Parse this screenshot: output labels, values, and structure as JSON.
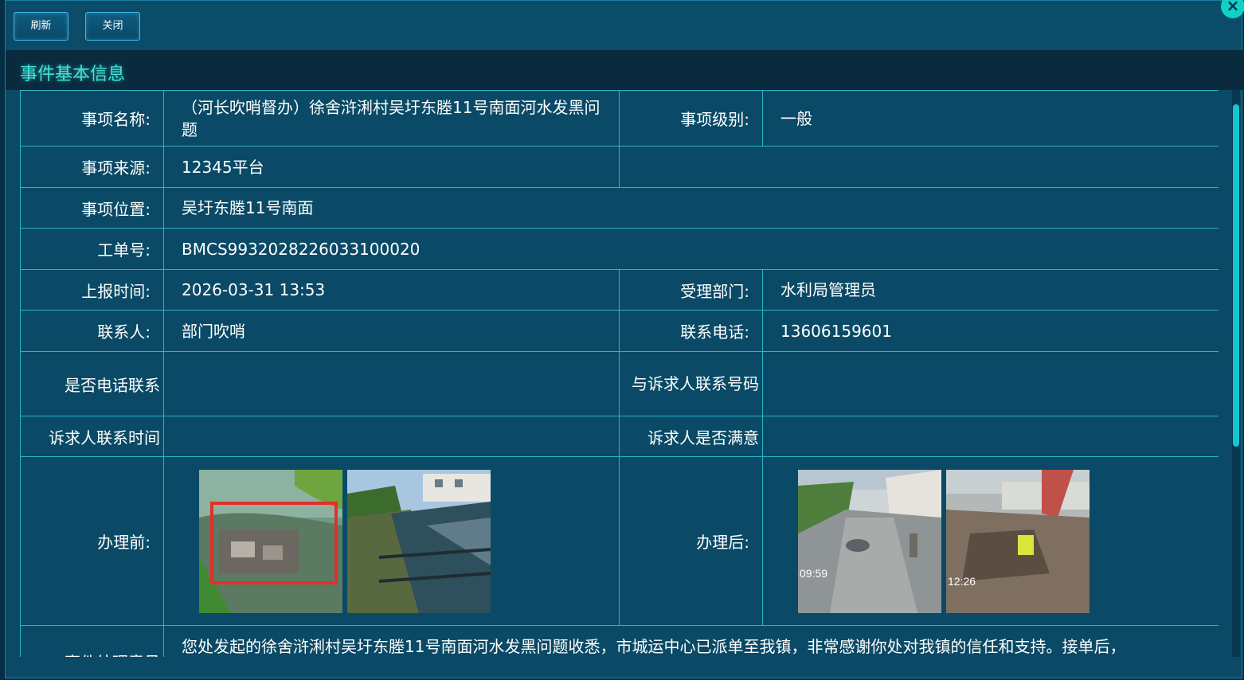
{
  "toolbar": {
    "refresh_label": "刷新",
    "close_label": "关闭"
  },
  "section": {
    "title": "事件基本信息"
  },
  "fields": {
    "item_name_label": "事项名称:",
    "item_name": "（河长吹哨督办）徐舍浒浰村吴圩东塍11号南面河水发黑问题",
    "item_level_label": "事项级别:",
    "item_level": "一般",
    "source_label": "事项来源:",
    "source": "12345平台",
    "location_label": "事项位置:",
    "location": "吴圩东塍11号南面",
    "order_no_label": "工单号:",
    "order_no": "BMCS993202822603310002​0",
    "report_time_label": "上报时间:",
    "report_time": "2026-03-31 13:53",
    "dept_label": "受理部门:",
    "dept": "水利局管理员",
    "contact_label": "联系人:",
    "contact": "部门吹哨",
    "phone_label": "联系电话:",
    "phone": "13606159601",
    "phone_contacted_label": "是否电话联系",
    "complainant_phone_label": "与诉求人联系号码",
    "complainant_time_label": "诉求人联系时间",
    "complainant_satisfied_label": "诉求人是否满意",
    "before_label": "办理前:",
    "after_label": "办理后:",
    "opinion_label": "事件处理意见",
    "opinion": "您处发起的徐舍浒浰村吴圩东塍11号南面河水发黑问题收悉，市城运中心已派单至我镇，非常感谢你处对我镇的信任和支持。接单后，"
  },
  "photos": {
    "after_1_time": "09:59",
    "after_2_time": "12:26"
  },
  "colors": {
    "accent": "#3fe6d8",
    "border": "#2ab3c9",
    "panel_bg": "#0a4a66"
  }
}
